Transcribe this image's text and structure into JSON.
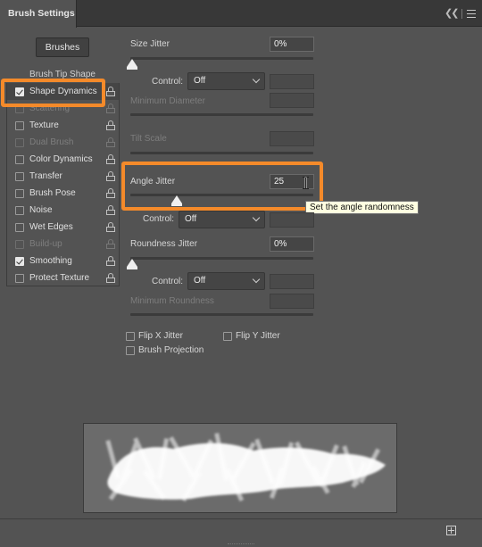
{
  "panel": {
    "title": "Brush Settings"
  },
  "brushes_button": "Brushes",
  "options": {
    "header": "Brush Tip Shape",
    "items": [
      {
        "label": "Shape Dynamics",
        "checked": true,
        "enabled": true,
        "active": true
      },
      {
        "label": "Scattering",
        "checked": false,
        "enabled": false
      },
      {
        "label": "Texture",
        "checked": false,
        "enabled": true
      },
      {
        "label": "Dual Brush",
        "checked": false,
        "enabled": false
      },
      {
        "label": "Color Dynamics",
        "checked": false,
        "enabled": true
      },
      {
        "label": "Transfer",
        "checked": false,
        "enabled": true
      },
      {
        "label": "Brush Pose",
        "checked": false,
        "enabled": true
      },
      {
        "label": "Noise",
        "checked": false,
        "enabled": true
      },
      {
        "label": "Wet Edges",
        "checked": false,
        "enabled": true
      },
      {
        "label": "Build-up",
        "checked": false,
        "enabled": false
      },
      {
        "label": "Smoothing",
        "checked": true,
        "enabled": true
      },
      {
        "label": "Protect Texture",
        "checked": false,
        "enabled": true
      }
    ]
  },
  "settings": {
    "size_jitter": {
      "label": "Size Jitter",
      "value": "0%",
      "level": 0
    },
    "control1": {
      "label": "Control:",
      "value": "Off"
    },
    "minimum_diameter": {
      "label": "Minimum Diameter",
      "value": ""
    },
    "tilt_scale": {
      "label": "Tilt Scale",
      "value": ""
    },
    "angle_jitter": {
      "label": "Angle Jitter",
      "value": "25",
      "level": 0.25
    },
    "control2": {
      "label": "Control:",
      "value": "Off"
    },
    "roundness_jitter": {
      "label": "Roundness Jitter",
      "value": "0%",
      "level": 0
    },
    "control3": {
      "label": "Control:",
      "value": "Off"
    },
    "minimum_roundness": {
      "label": "Minimum Roundness",
      "value": ""
    },
    "flip_x": {
      "label": "Flip X Jitter",
      "checked": false
    },
    "flip_y": {
      "label": "Flip Y Jitter",
      "checked": false
    },
    "brush_projection": {
      "label": "Brush Projection",
      "checked": false
    }
  },
  "tooltip": "Set the angle randomness",
  "icons": {
    "collapse": "double-chevron-left-icon",
    "menu": "hamburger-menu-icon",
    "lock": "lock-icon",
    "new": "new-brush-icon"
  },
  "colors": {
    "highlight": "#f48a2a",
    "panel": "#535353",
    "tooltip": "#ffffe1"
  }
}
